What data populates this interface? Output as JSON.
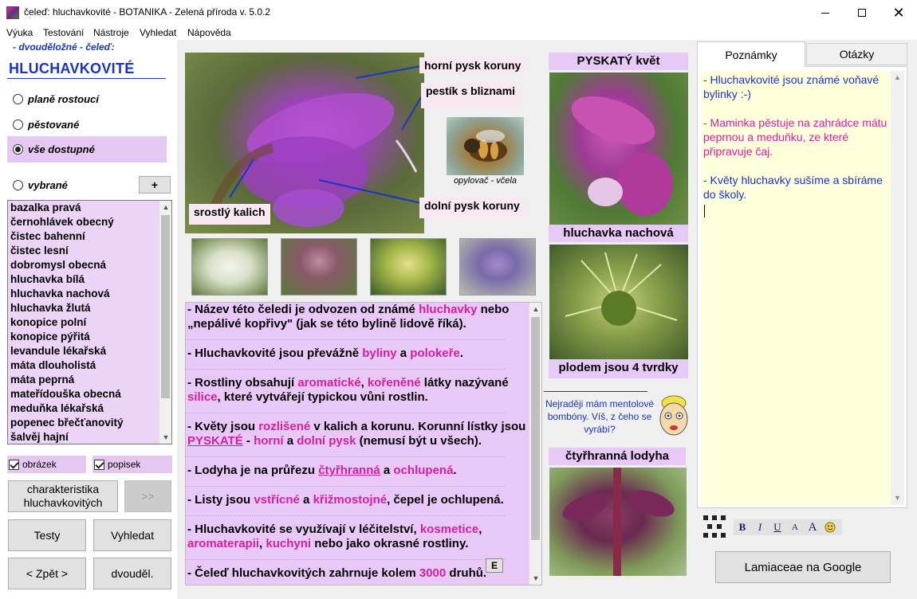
{
  "window": {
    "title": "čeleď: hluchavkovité - BOTANIKA - Zelená příroda v. 5.0.2"
  },
  "menu": [
    "Výuka",
    "Testování",
    "Nástroje",
    "Vyhledat",
    "Nápověda"
  ],
  "left": {
    "category": "- dvouděložné - čeleď:",
    "family": "HLUCHAVKOVITÉ",
    "radios": [
      {
        "label": "planě rostoucí",
        "selected": false
      },
      {
        "label": "pěstované",
        "selected": false
      },
      {
        "label": "vše dostupné",
        "selected": true
      },
      {
        "label": "vybrané",
        "selected": false
      }
    ],
    "plus_label": "+",
    "species": [
      "bazalka pravá",
      "černohlávek obecný",
      "čistec bahenní",
      "čistec lesní",
      "dobromysl obecná",
      "hluchavka bílá",
      "hluchavka nachová",
      "hluchavka žlutá",
      "konopice polní",
      "konopice pýřitá",
      "levandule lékařská",
      "máta dlouholistá",
      "máta peprná",
      "mateřídouška obecná",
      "meduňka lékařská",
      "popenec břečťanovitý",
      "šalvěj hajní"
    ],
    "check_image": "obrázek",
    "check_description": "popisek",
    "btn_characteristics": "charakteristika hluchavkovitých",
    "btn_next": ">>",
    "btn_tests": "Testy",
    "btn_search": "Vyhledat",
    "btn_back": "< Zpět >",
    "btn_dicot": "dvouděl."
  },
  "middle": {
    "labels": {
      "upper_lip": "horní pysk koruny",
      "pistil": "pestík s bliznami",
      "calyx": "srostlý kalich",
      "lower_lip": "dolní pysk koruny",
      "pollinator": "opylovač - včela"
    },
    "paragraphs": [
      [
        [
          "- Název této čeledi je odvozen od známé ",
          ""
        ],
        [
          "hluchavky",
          "kw"
        ],
        [
          " nebo „nepálivé kopřivy\" (jak se této bylině lidově říká).",
          ""
        ]
      ],
      [
        [
          "- Hluchavkovité jsou převážně ",
          ""
        ],
        [
          "byliny",
          "kw"
        ],
        [
          " a ",
          ""
        ],
        [
          "polokeře",
          "kw"
        ],
        [
          ".",
          ""
        ]
      ],
      [
        [
          "- Rostliny obsahují ",
          ""
        ],
        [
          "aromatické",
          "kw"
        ],
        [
          ", ",
          ""
        ],
        [
          "kořeněné",
          "kw"
        ],
        [
          " látky nazývané ",
          ""
        ],
        [
          "silice",
          "kw"
        ],
        [
          ", které vytvářejí typickou vůni rostlin.",
          ""
        ]
      ],
      [
        [
          "- Květy jsou ",
          ""
        ],
        [
          "rozlišené",
          "kw"
        ],
        [
          " v kalich a korunu. Korunní lístky jsou ",
          ""
        ],
        [
          "PYSKATÉ",
          "kw-u"
        ],
        [
          " - ",
          ""
        ],
        [
          "horní",
          "kw"
        ],
        [
          " a ",
          ""
        ],
        [
          "dolní pysk",
          "kw"
        ],
        [
          " (nemusí být u všech).",
          ""
        ]
      ],
      [
        [
          "- Lodyha je na průřezu ",
          ""
        ],
        [
          "čtyřhranná",
          "kw-u"
        ],
        [
          " a ",
          ""
        ],
        [
          "ochlupená",
          "kw"
        ],
        [
          ".",
          ""
        ]
      ],
      [
        [
          "- Listy jsou ",
          ""
        ],
        [
          "vstřícné",
          "kw"
        ],
        [
          " a ",
          ""
        ],
        [
          "křižmostojné",
          "kw"
        ],
        [
          ", čepel je ochlupená.",
          ""
        ]
      ],
      [
        [
          "- Hluchavkovité se využívají v léčitelství, ",
          ""
        ],
        [
          "kosmetice",
          "kw"
        ],
        [
          ", ",
          ""
        ],
        [
          "aromaterapii",
          "kw"
        ],
        [
          ", ",
          ""
        ],
        [
          "kuchyni",
          "kw"
        ],
        [
          " nebo jako okrasné rostliny.",
          ""
        ]
      ],
      [
        [
          "- Čeleď hluchavkovitých zahrnuje kolem ",
          ""
        ],
        [
          "3000",
          "kw"
        ],
        [
          " druhů.",
          ""
        ]
      ]
    ],
    "e_label": "E",
    "side": {
      "flower_title": "PYSKATÝ květ",
      "plant_name": "hluchavka nachová",
      "fruit_caption": "plodem jsou 4 tvrdky",
      "speech": "Nejraději mám mentolové bombóny. Víš, z čeho se vyrábí?",
      "stem_title": "čtyřhranná lodyha"
    }
  },
  "right": {
    "tab_notes": "Poznámky",
    "tab_questions": "Otázky",
    "notes": [
      {
        "text": "- Hluchavkovité jsou známé voňavé bylinky :-)",
        "color": "blue"
      },
      {
        "text": "- Maminka pěstuje na zahrádce mátu peprnou a meduňku, ze které připravuje čaj.",
        "color": "pink"
      },
      {
        "text": "- Květy hluchavky sušíme a sbíráme do školy.",
        "color": "blue"
      }
    ],
    "format": {
      "bold": "B",
      "italic": "I",
      "underline": "U",
      "smaller": "A",
      "bigger": "A"
    },
    "google_button": "Lamiaceae na Google"
  },
  "colors": {
    "accent_blue": "#1a33c8",
    "keyword_pink": "#d3209c",
    "panel_lilac": "#e8c8f6",
    "notes_yellow": "#ffffdc"
  }
}
